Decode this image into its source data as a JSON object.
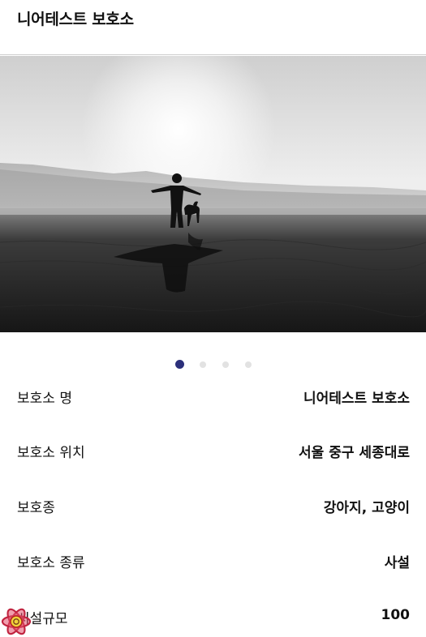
{
  "header": {
    "title": "니어테스트 보호소"
  },
  "hero": {
    "icon": "beach-photo"
  },
  "carousel": {
    "total": 4,
    "active_index": 0
  },
  "details": [
    {
      "label": "보호소 명",
      "value": "니어테스트 보호소"
    },
    {
      "label": "보호소 위치",
      "value": "서울 중구 세종대로"
    },
    {
      "label": "보호종",
      "value": "강아지, 고양이"
    },
    {
      "label": "보호소 종류",
      "value": "사설"
    },
    {
      "label": "시설규모",
      "value": "100"
    }
  ],
  "colors": {
    "active_dot": "#2b2f7a",
    "inactive_dot": "#e2e2e2",
    "divider": "#cfcfcf"
  },
  "overlay": {
    "icon": "react-devtools-icon"
  }
}
